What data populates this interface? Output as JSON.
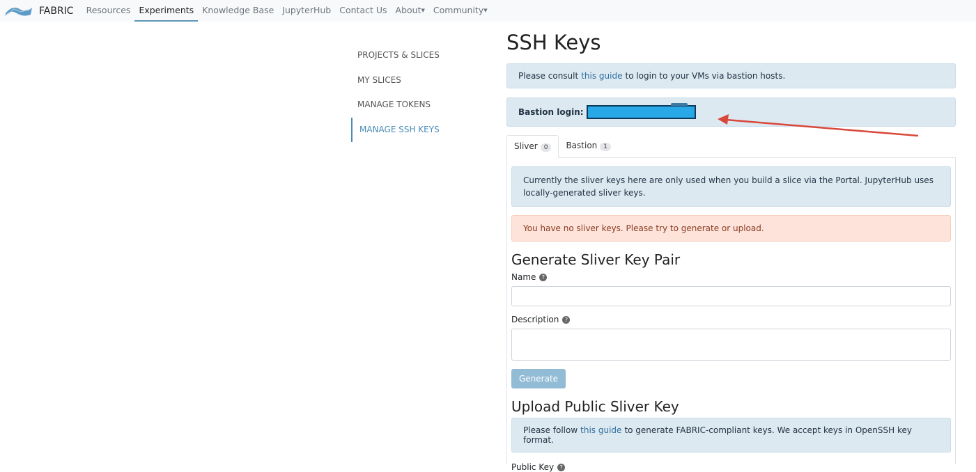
{
  "nav": {
    "brand": "FABRIC",
    "items": [
      "Resources",
      "Experiments",
      "Knowledge Base",
      "JupyterHub",
      "Contact Us",
      "About",
      "Community"
    ]
  },
  "sidebar": {
    "items": [
      "PROJECTS & SLICES",
      "MY SLICES",
      "MANAGE TOKENS",
      "MANAGE SSH KEYS"
    ]
  },
  "main": {
    "title": "SSH Keys",
    "guide_pre": "Please consult",
    "guide_link": "this guide",
    "guide_post": "to login to your VMs via bastion hosts.",
    "bastion_label": "Bastion login:",
    "tabs": [
      {
        "label": "Sliver",
        "count": "0"
      },
      {
        "label": "Bastion",
        "count": "1"
      }
    ],
    "info": "Currently the sliver keys here are only used when you build a slice via the Portal. JupyterHub uses locally-generated sliver keys.",
    "warning": "You have no sliver keys. Please try to generate or upload.",
    "generate_title": "Generate Sliver Key Pair",
    "name_label": "Name",
    "description_label": "Description",
    "help": "?",
    "generate_button": "Generate",
    "upload_title": "Upload Public Sliver Key",
    "upload_pre": "Please follow",
    "upload_link": "this guide",
    "upload_post": "to generate FABRIC-compliant keys. We accept keys in OpenSSH key format.",
    "public_key_label": "Public Key"
  }
}
